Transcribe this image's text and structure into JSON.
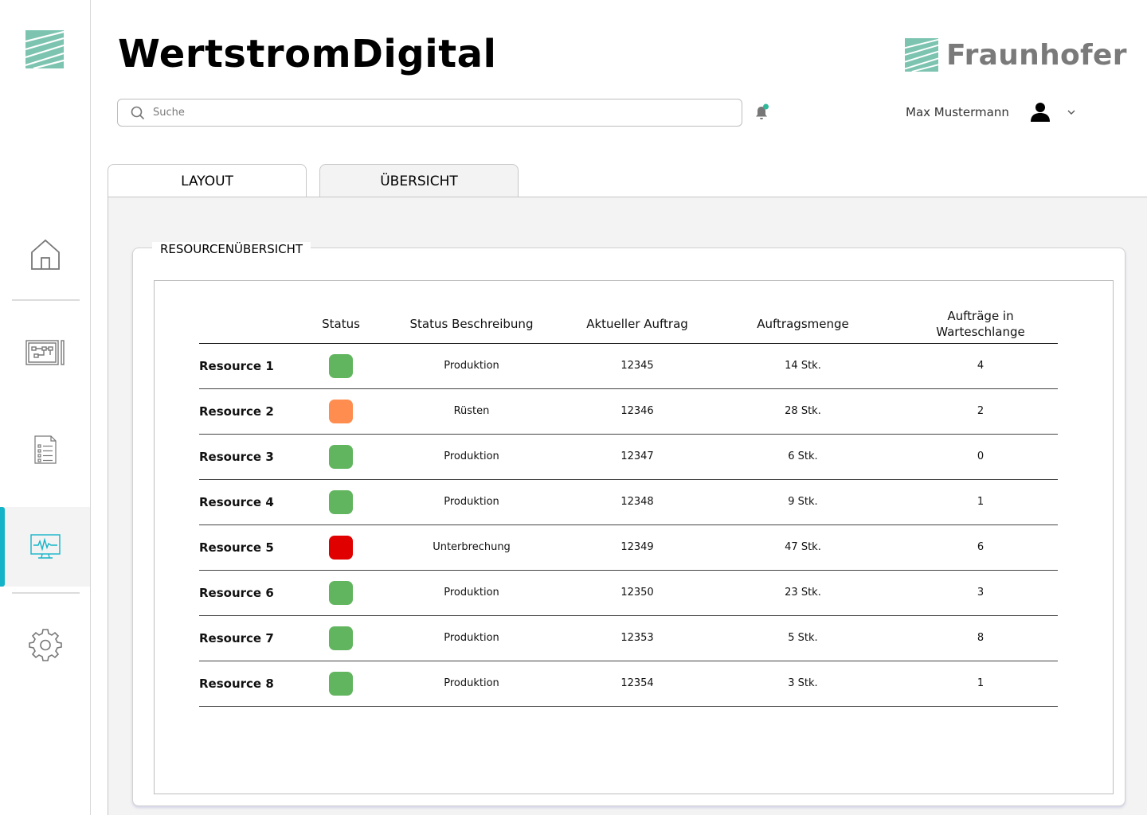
{
  "app": {
    "title": "WertstromDigital",
    "brand_name": "Fraunhofer"
  },
  "search": {
    "placeholder": "Suche"
  },
  "user": {
    "name": "Max Mustermann"
  },
  "sidebar": {
    "items": [
      {
        "id": "home",
        "icon": "home-icon"
      },
      {
        "id": "layout",
        "icon": "layout-board-icon"
      },
      {
        "id": "list",
        "icon": "checklist-icon"
      },
      {
        "id": "monitor",
        "icon": "monitor-pulse-icon",
        "active": true
      },
      {
        "id": "settings",
        "icon": "gear-icon"
      }
    ]
  },
  "tabs": [
    {
      "label": "LAYOUT",
      "active": false
    },
    {
      "label": "ÜBERSICHT",
      "active": true
    }
  ],
  "overview": {
    "title": "RESOURCENÜBERSICHT",
    "columns": [
      "",
      "Status",
      "Status Beschreibung",
      "Aktueller Auftrag",
      "Auftragsmenge",
      "Aufträge in Warteschlange"
    ],
    "rows": [
      {
        "name": "Resource 1",
        "status_color": "#62b55f",
        "description": "Produktion",
        "order": "12345",
        "quantity": "14 Stk.",
        "queue": "4"
      },
      {
        "name": "Resource 2",
        "status_color": "#ff8d4f",
        "description": "Rüsten",
        "order": "12346",
        "quantity": "28 Stk.",
        "queue": "2"
      },
      {
        "name": "Resource 3",
        "status_color": "#62b55f",
        "description": "Produktion",
        "order": "12347",
        "quantity": "6 Stk.",
        "queue": "0"
      },
      {
        "name": "Resource 4",
        "status_color": "#62b55f",
        "description": "Produktion",
        "order": "12348",
        "quantity": "9 Stk.",
        "queue": "1"
      },
      {
        "name": "Resource 5",
        "status_color": "#e00000",
        "description": "Unterbrechung",
        "order": "12349",
        "quantity": "47 Stk.",
        "queue": "6"
      },
      {
        "name": "Resource 6",
        "status_color": "#62b55f",
        "description": "Produktion",
        "order": "12350",
        "quantity": "23 Stk.",
        "queue": "3"
      },
      {
        "name": "Resource 7",
        "status_color": "#62b55f",
        "description": "Produktion",
        "order": "12353",
        "quantity": "5 Stk.",
        "queue": "8"
      },
      {
        "name": "Resource 8",
        "status_color": "#62b55f",
        "description": "Produktion",
        "order": "12354",
        "quantity": "3 Stk.",
        "queue": "1"
      }
    ]
  },
  "colors": {
    "accent": "#14b4c8",
    "brand_green": "#7cc4b0",
    "notification": "#2fb89a"
  }
}
